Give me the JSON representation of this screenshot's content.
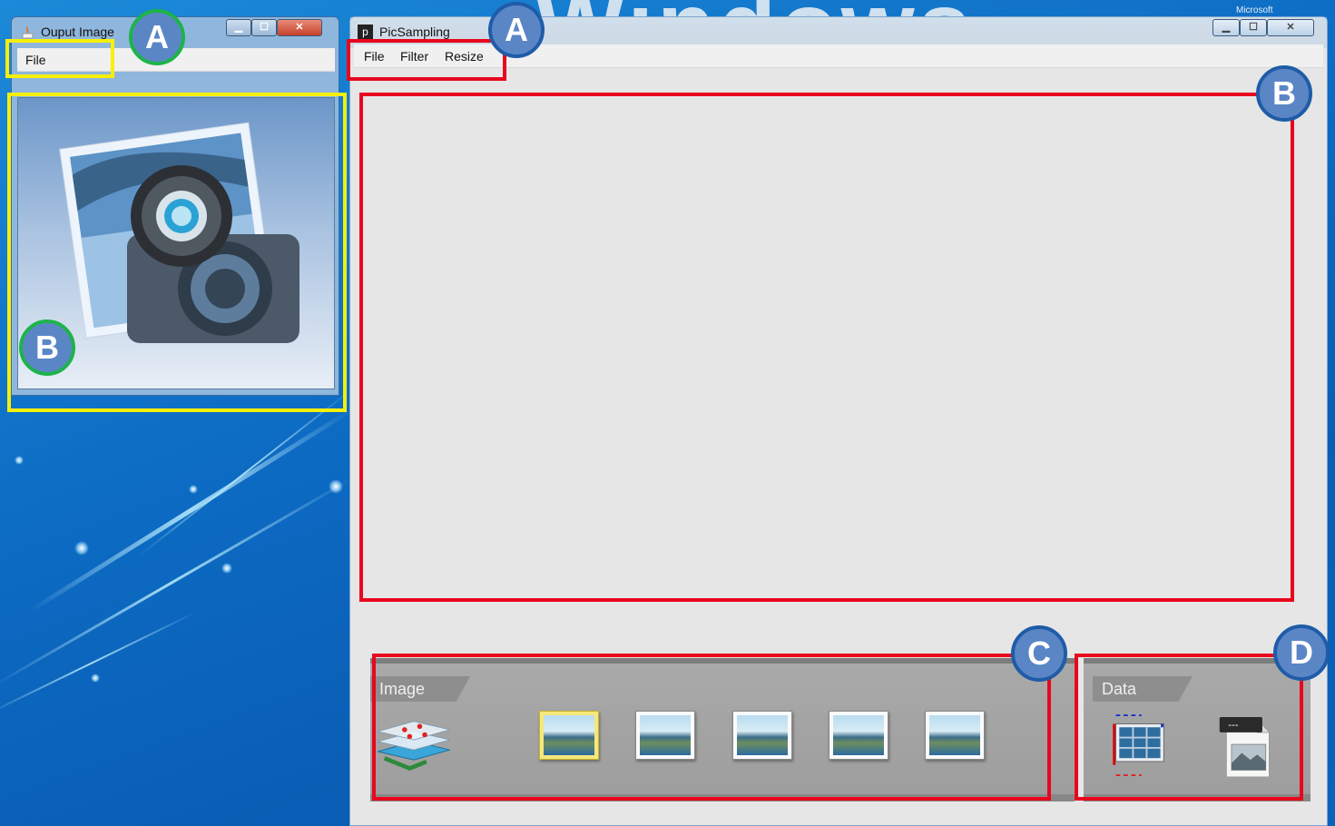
{
  "output_window": {
    "title": "Ouput Image",
    "menu": [
      "File"
    ],
    "controls": [
      "minimize",
      "maximize",
      "close"
    ]
  },
  "main_window": {
    "title": "PicSampling",
    "app_icon_letter": "p",
    "menu": [
      "File",
      "Filter",
      "Resize"
    ],
    "controls": [
      "minimize",
      "maximize",
      "close"
    ]
  },
  "desktop": {
    "watermark": "Windows",
    "watermark_small": "Microsoft"
  },
  "panels": {
    "image": {
      "label": "Image",
      "thumbnail_count": 5,
      "selected_index": 0
    },
    "data": {
      "label": "Data"
    }
  },
  "annotations": {
    "badges": [
      "A",
      "B",
      "A",
      "B",
      "C",
      "D"
    ],
    "colors": {
      "red_box": "#e8071e",
      "yellow_box": "#f5ef0a",
      "badge_fill": "#5b86c6",
      "badge_blue_ring": "#1f5ca8",
      "badge_green_ring": "#1db34a"
    }
  }
}
